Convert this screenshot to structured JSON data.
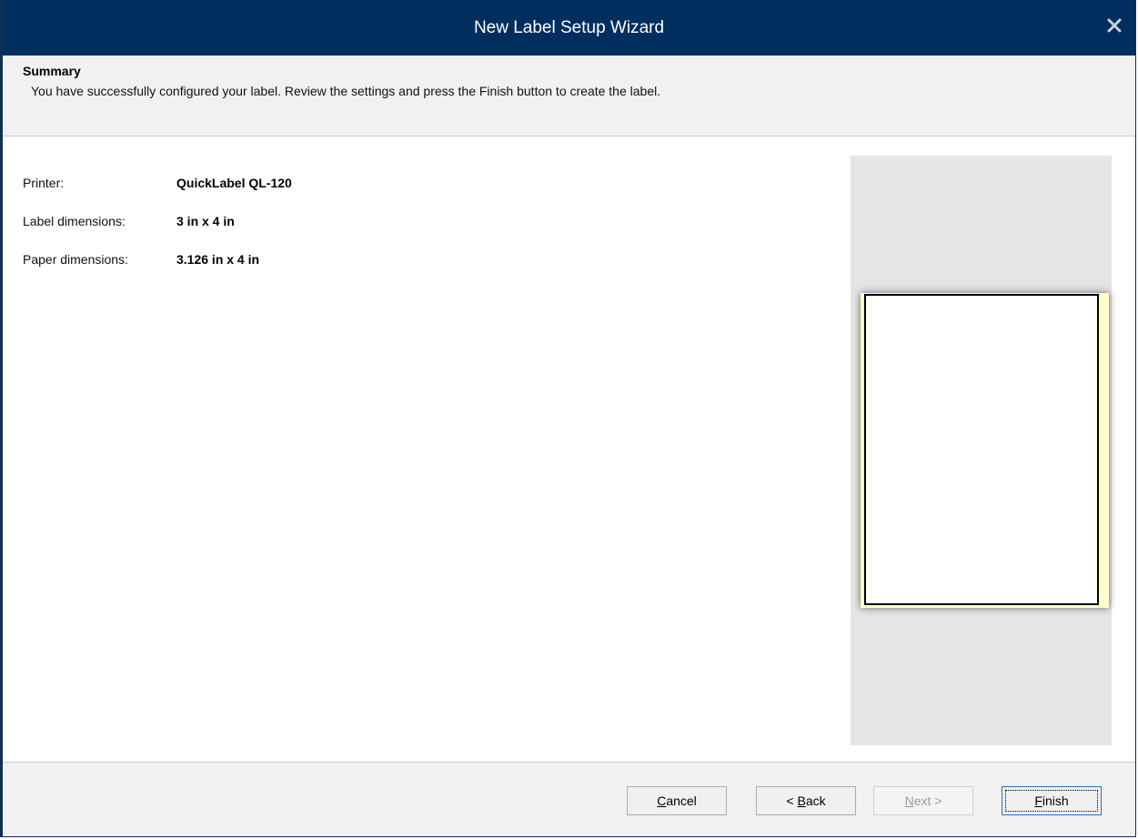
{
  "window": {
    "title": "New Label Setup Wizard"
  },
  "header": {
    "title": "Summary",
    "description": "You have successfully configured your label. Review the settings and press the Finish button to create the label."
  },
  "summary": {
    "rows": [
      {
        "label": "Printer:",
        "value": "QuickLabel QL-120"
      },
      {
        "label": "Label dimensions:",
        "value": "3 in x 4 in"
      },
      {
        "label": "Paper dimensions:",
        "value": "3.126 in x 4 in"
      }
    ]
  },
  "buttons": {
    "cancel": {
      "accel": "C",
      "rest": "ancel"
    },
    "back": {
      "prefix": "< ",
      "accel": "B",
      "rest": "ack"
    },
    "next": {
      "accel": "N",
      "rest": "ext >"
    },
    "finish": {
      "accel": "F",
      "rest": "inish"
    }
  },
  "colors": {
    "titlebar": "#002e5e",
    "paper": "#ffffcc",
    "preview_bg": "#e5e5e5"
  },
  "icons": {
    "close": "close-icon"
  }
}
